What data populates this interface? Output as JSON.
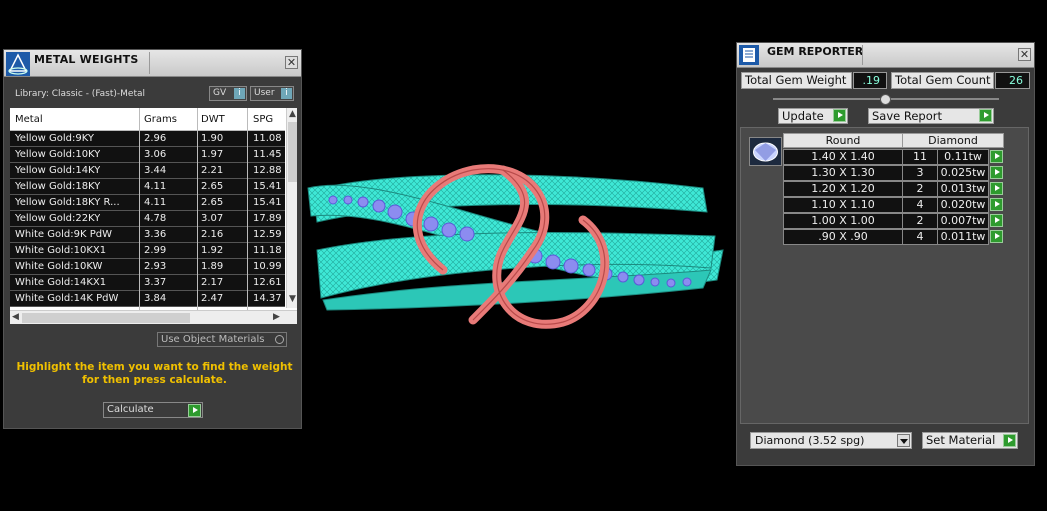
{
  "metal_weights": {
    "title": "METAL WEIGHTS",
    "library_label": "Library: Classic - (Fast)-Metal",
    "gv_label": "GV",
    "user_label": "User",
    "chip_check": "i",
    "columns": [
      "Metal",
      "Grams",
      "DWT",
      "SPG"
    ],
    "rows": [
      [
        "Yellow Gold:9KY",
        "2.96",
        "1.90",
        "11.08"
      ],
      [
        "Yellow Gold:10KY",
        "3.06",
        "1.97",
        "11.45"
      ],
      [
        "Yellow Gold:14KY",
        "3.44",
        "2.21",
        "12.88"
      ],
      [
        "Yellow Gold:18KY",
        "4.11",
        "2.65",
        "15.41"
      ],
      [
        "Yellow Gold:18KY R...",
        "4.11",
        "2.65",
        "15.41"
      ],
      [
        "Yellow Gold:22KY",
        "4.78",
        "3.07",
        "17.89"
      ],
      [
        "White Gold:9K PdW",
        "3.36",
        "2.16",
        "12.59"
      ],
      [
        "White Gold:10KX1",
        "2.99",
        "1.92",
        "11.18"
      ],
      [
        "White Gold:10KW",
        "2.93",
        "1.89",
        "10.99"
      ],
      [
        "White Gold:14KX1",
        "3.37",
        "2.17",
        "12.61"
      ],
      [
        "White Gold:14K PdW",
        "3.84",
        "2.47",
        "14.37"
      ]
    ],
    "use_object_materials": "Use Object Materials",
    "hint": "Highlight the item you want to find the weight for then press calculate.",
    "calculate_label": "Calculate",
    "close_glyph": "✕"
  },
  "gem_reporter": {
    "title": "GEM REPORTER",
    "total_weight_label": "Total Gem Weight",
    "total_weight_value": ".19",
    "total_count_label": "Total Gem Count",
    "total_count_value": "26",
    "update_label": "Update",
    "save_report_label": "Save Report",
    "headers": [
      "Round",
      "Diamond"
    ],
    "gems": [
      [
        "1.40 X 1.40",
        "11",
        "0.11tw"
      ],
      [
        "1.30 X 1.30",
        "3",
        "0.025tw"
      ],
      [
        "1.20 X 1.20",
        "2",
        "0.013tw"
      ],
      [
        "1.10 X 1.10",
        "4",
        "0.020tw"
      ],
      [
        "1.00 X 1.00",
        "2",
        "0.007tw"
      ],
      [
        ".90 X .90",
        "4",
        "0.011tw"
      ]
    ],
    "material_value": "Diamond    (3.52 spg)",
    "set_material_label": "Set Material",
    "close_glyph": "✕"
  },
  "colors": {
    "ring_band": "#3ee8d6",
    "ring_knot": "#e87a78",
    "gems": "#8c8cf0",
    "hint_text": "#f0c000",
    "go_button": "#2e9b2e"
  }
}
